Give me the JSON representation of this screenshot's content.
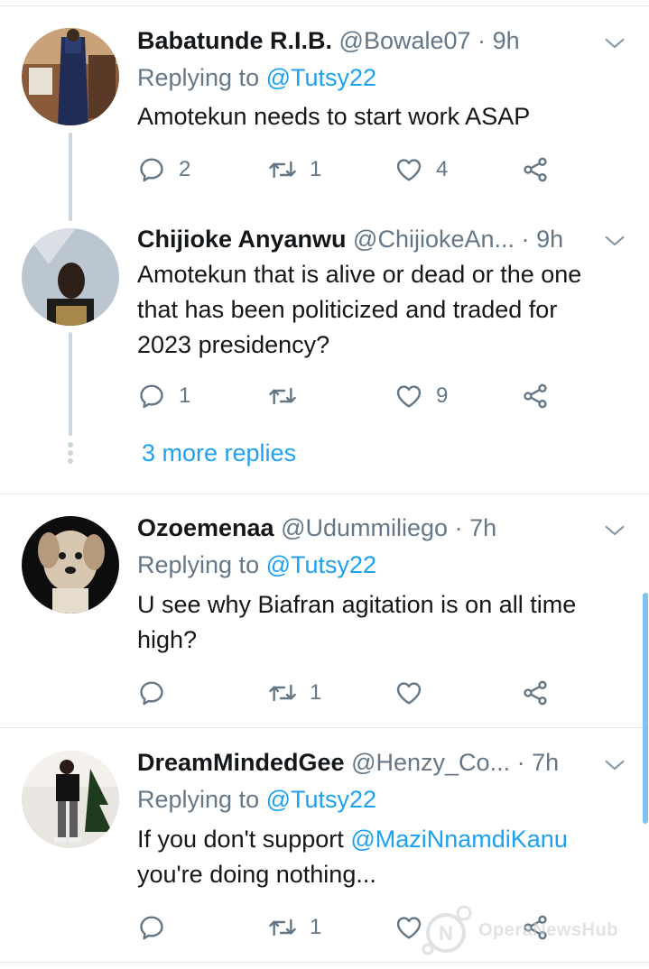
{
  "tweets": [
    {
      "name": "Babatunde R.I.B.",
      "handle": "@Bowale07",
      "sep": "·",
      "time": "9h",
      "replying_prefix": "Replying to",
      "replying_handle": "@Tutsy22",
      "body": "Amotekun needs to start work ASAP",
      "replies": "2",
      "retweets": "1",
      "likes": "4"
    },
    {
      "name": "Chijioke Anyanwu",
      "handle": "@ChijiokeAn...",
      "sep": "·",
      "time": "9h",
      "body_lines": [
        "Amotekun that is alive or dead or the one",
        "that has been politicized and traded for",
        "2023 presidency?"
      ],
      "replies": "1",
      "retweets": "",
      "likes": "9"
    },
    {
      "name": "Ozoemenaa",
      "handle": "@Udummiliego",
      "sep": "·",
      "time": "7h",
      "replying_prefix": "Replying to",
      "replying_handle": "@Tutsy22",
      "body_lines": [
        "U see why Biafran agitation is on all time",
        "high?"
      ],
      "replies": "",
      "retweets": "1",
      "likes": ""
    },
    {
      "name": "DreamMindedGee",
      "handle": "@Henzy_Co...",
      "sep": "·",
      "time": "7h",
      "replying_prefix": "Replying to",
      "replying_handle": "@Tutsy22",
      "body_line1_prefix": "If you don't support",
      "body_line1_mention": "@MaziNnamdiKanu",
      "body_line2": "you're doing nothing...",
      "replies": "",
      "retweets": "1",
      "likes": ""
    }
  ],
  "more_replies": "3 more replies",
  "watermark": {
    "text": "OperaNewsHub",
    "icon": "opera-news-logo-icon"
  },
  "colors": {
    "accent": "#1da1f2",
    "muted": "#657786",
    "divider": "#e1e8ed",
    "thread": "#ccd6dd"
  }
}
